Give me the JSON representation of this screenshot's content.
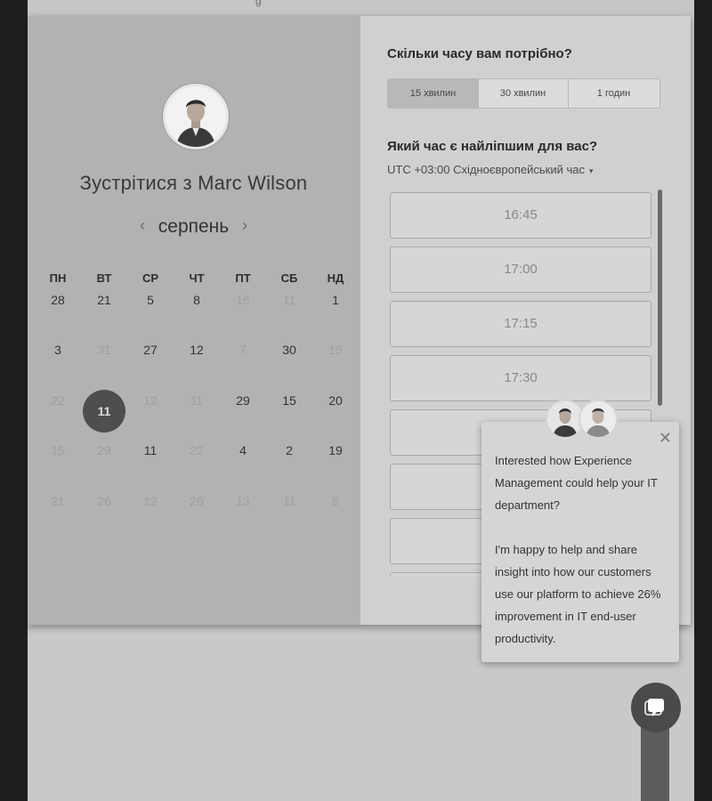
{
  "top": {
    "fragment": "g"
  },
  "scheduler": {
    "meet_title": "Зустрітися з Marc Wilson",
    "month": "серпень",
    "prev_icon": "chevron-left-icon",
    "next_icon": "chevron-right-icon",
    "weekdays": [
      "ПН",
      "ВТ",
      "СР",
      "ЧТ",
      "ПТ",
      "СБ",
      "НД"
    ],
    "weeks": [
      [
        {
          "d": "28",
          "muted": false
        },
        {
          "d": "21",
          "muted": false
        },
        {
          "d": "5",
          "muted": false
        },
        {
          "d": "8",
          "muted": false
        },
        {
          "d": "16",
          "muted": true
        },
        {
          "d": "11",
          "muted": true
        },
        {
          "d": "1",
          "muted": false
        }
      ],
      [
        {
          "d": "3",
          "muted": false
        },
        {
          "d": "31",
          "muted": true
        },
        {
          "d": "27",
          "muted": false
        },
        {
          "d": "12",
          "muted": false
        },
        {
          "d": "7",
          "muted": true
        },
        {
          "d": "30",
          "muted": false
        },
        {
          "d": "15",
          "muted": true
        }
      ],
      [
        {
          "d": "22",
          "muted": true
        },
        {
          "d": "11",
          "muted": false,
          "selected": true
        },
        {
          "d": "12",
          "muted": true
        },
        {
          "d": "11",
          "muted": true
        },
        {
          "d": "29",
          "muted": false
        },
        {
          "d": "15",
          "muted": false
        },
        {
          "d": "20",
          "muted": false
        }
      ],
      [
        {
          "d": "15",
          "muted": true
        },
        {
          "d": "29",
          "muted": true
        },
        {
          "d": "11",
          "muted": false
        },
        {
          "d": "22",
          "muted": true
        },
        {
          "d": "4",
          "muted": false
        },
        {
          "d": "2",
          "muted": false
        },
        {
          "d": "19",
          "muted": false
        }
      ],
      [
        {
          "d": "21",
          "muted": true
        },
        {
          "d": "26",
          "muted": true
        },
        {
          "d": "12",
          "muted": true
        },
        {
          "d": "26",
          "muted": true
        },
        {
          "d": "13",
          "muted": true
        },
        {
          "d": "11",
          "muted": true
        },
        {
          "d": "5",
          "muted": true
        }
      ]
    ]
  },
  "booking": {
    "duration_question": "Скільки часу вам потрібно?",
    "durations": [
      "15 хвилин",
      "30 хвилин",
      "1 годин"
    ],
    "selected_duration": "15 хвилин",
    "time_question": "Який час є найліпшим для вас?",
    "timezone": "UTC +03:00 Східноєвропейський час",
    "timezone_caret": "▾",
    "slots": [
      "16:45",
      "17:00",
      "17:15",
      "17:30",
      "",
      "",
      "",
      ""
    ]
  },
  "chat_popup": {
    "close_symbol": "✕",
    "paragraph1": "Interested how Experience Management could help your IT department?",
    "paragraph2": "I'm happy to help and share insight into how our customers use our platform to achieve 26% improvement in IT end-user productivity."
  },
  "colors": {
    "selected_day": "#4e4e4e",
    "chat_button": "#4a4a4a"
  }
}
